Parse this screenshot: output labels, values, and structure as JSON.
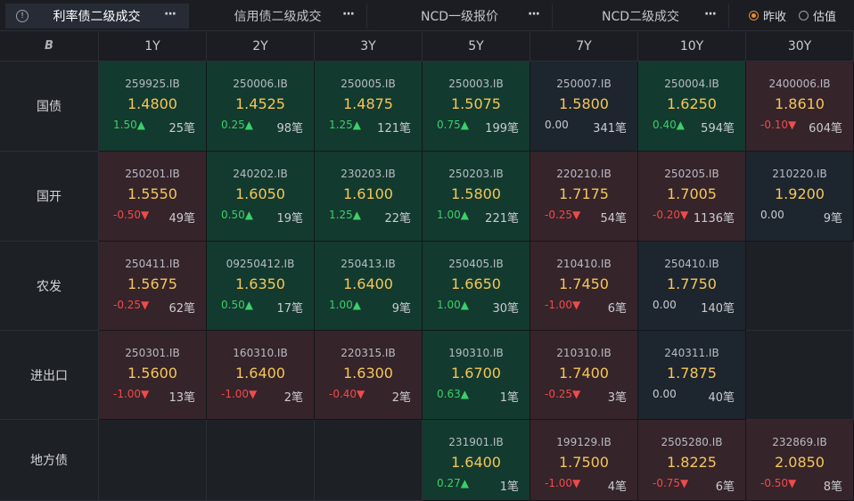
{
  "tabs": [
    {
      "label": "利率债二级成交",
      "active": true
    },
    {
      "label": "信用债二级成交",
      "active": false
    },
    {
      "label": "NCD一级报价",
      "active": false
    },
    {
      "label": "NCD二级成交",
      "active": false
    }
  ],
  "radio": {
    "option1": "昨收",
    "option2": "估值",
    "selected": "昨收"
  },
  "corner_label": "B",
  "columns": [
    "1Y",
    "2Y",
    "3Y",
    "5Y",
    "7Y",
    "10Y",
    "30Y"
  ],
  "rows": [
    {
      "name": "国债",
      "cells": [
        {
          "code": "259925.IB",
          "yield": "1.4800",
          "change": "1.50▲",
          "dir": "up",
          "count": "25笔",
          "tone": "green"
        },
        {
          "code": "250006.IB",
          "yield": "1.4525",
          "change": "0.25▲",
          "dir": "up",
          "count": "98笔",
          "tone": "green"
        },
        {
          "code": "250005.IB",
          "yield": "1.4875",
          "change": "1.25▲",
          "dir": "up",
          "count": "121笔",
          "tone": "green"
        },
        {
          "code": "250003.IB",
          "yield": "1.5075",
          "change": "0.75▲",
          "dir": "up",
          "count": "199笔",
          "tone": "green"
        },
        {
          "code": "250007.IB",
          "yield": "1.5800",
          "change": "0.00",
          "dir": "flat",
          "count": "341笔",
          "tone": "neutral"
        },
        {
          "code": "250004.IB",
          "yield": "1.6250",
          "change": "0.40▲",
          "dir": "up",
          "count": "594笔",
          "tone": "green"
        },
        {
          "code": "2400006.IB",
          "yield": "1.8610",
          "change": "-0.10▼",
          "dir": "down",
          "count": "604笔",
          "tone": "red"
        }
      ]
    },
    {
      "name": "国开",
      "cells": [
        {
          "code": "250201.IB",
          "yield": "1.5550",
          "change": "-0.50▼",
          "dir": "down",
          "count": "49笔",
          "tone": "red"
        },
        {
          "code": "240202.IB",
          "yield": "1.6050",
          "change": "0.50▲",
          "dir": "up",
          "count": "19笔",
          "tone": "green"
        },
        {
          "code": "230203.IB",
          "yield": "1.6100",
          "change": "1.25▲",
          "dir": "up",
          "count": "22笔",
          "tone": "green"
        },
        {
          "code": "250203.IB",
          "yield": "1.5800",
          "change": "1.00▲",
          "dir": "up",
          "count": "221笔",
          "tone": "green"
        },
        {
          "code": "220210.IB",
          "yield": "1.7175",
          "change": "-0.25▼",
          "dir": "down",
          "count": "54笔",
          "tone": "red"
        },
        {
          "code": "250205.IB",
          "yield": "1.7005",
          "change": "-0.20▼",
          "dir": "down",
          "count": "1136笔",
          "tone": "red"
        },
        {
          "code": "210220.IB",
          "yield": "1.9200",
          "change": "0.00",
          "dir": "flat",
          "count": "9笔",
          "tone": "neutral"
        }
      ]
    },
    {
      "name": "农发",
      "cells": [
        {
          "code": "250411.IB",
          "yield": "1.5675",
          "change": "-0.25▼",
          "dir": "down",
          "count": "62笔",
          "tone": "red"
        },
        {
          "code": "09250412.IB",
          "yield": "1.6350",
          "change": "0.50▲",
          "dir": "up",
          "count": "17笔",
          "tone": "green"
        },
        {
          "code": "250413.IB",
          "yield": "1.6400",
          "change": "1.00▲",
          "dir": "up",
          "count": "9笔",
          "tone": "green"
        },
        {
          "code": "250405.IB",
          "yield": "1.6650",
          "change": "1.00▲",
          "dir": "up",
          "count": "30笔",
          "tone": "green"
        },
        {
          "code": "210410.IB",
          "yield": "1.7450",
          "change": "-1.00▼",
          "dir": "down",
          "count": "6笔",
          "tone": "red"
        },
        {
          "code": "250410.IB",
          "yield": "1.7750",
          "change": "0.00",
          "dir": "flat",
          "count": "140笔",
          "tone": "neutral"
        },
        null
      ]
    },
    {
      "name": "进出口",
      "cells": [
        {
          "code": "250301.IB",
          "yield": "1.5600",
          "change": "-1.00▼",
          "dir": "down",
          "count": "13笔",
          "tone": "red"
        },
        {
          "code": "160310.IB",
          "yield": "1.6400",
          "change": "-1.00▼",
          "dir": "down",
          "count": "2笔",
          "tone": "red"
        },
        {
          "code": "220315.IB",
          "yield": "1.6300",
          "change": "-0.40▼",
          "dir": "down",
          "count": "2笔",
          "tone": "red"
        },
        {
          "code": "190310.IB",
          "yield": "1.6700",
          "change": "0.63▲",
          "dir": "up",
          "count": "1笔",
          "tone": "green"
        },
        {
          "code": "210310.IB",
          "yield": "1.7400",
          "change": "-0.25▼",
          "dir": "down",
          "count": "3笔",
          "tone": "red"
        },
        {
          "code": "240311.IB",
          "yield": "1.7875",
          "change": "0.00",
          "dir": "flat",
          "count": "40笔",
          "tone": "neutral"
        },
        null
      ]
    },
    {
      "name": "地方债",
      "cells": [
        null,
        null,
        null,
        {
          "code": "231901.IB",
          "yield": "1.6400",
          "change": "0.27▲",
          "dir": "up",
          "count": "1笔",
          "tone": "green"
        },
        {
          "code": "199129.IB",
          "yield": "1.7500",
          "change": "-1.00▼",
          "dir": "down",
          "count": "4笔",
          "tone": "red"
        },
        {
          "code": "2505280.IB",
          "yield": "1.8225",
          "change": "-0.75▼",
          "dir": "down",
          "count": "6笔",
          "tone": "red"
        },
        {
          "code": "232869.IB",
          "yield": "2.0850",
          "change": "-0.50▼",
          "dir": "down",
          "count": "8笔",
          "tone": "red"
        }
      ]
    }
  ],
  "colors": {
    "up": "#3ccf6a",
    "down": "#f04a4a",
    "yield": "#f5c65a",
    "accent": "#f08a2c"
  },
  "icons": {
    "info": "info-circle-icon",
    "more": "more-dots-icon"
  }
}
